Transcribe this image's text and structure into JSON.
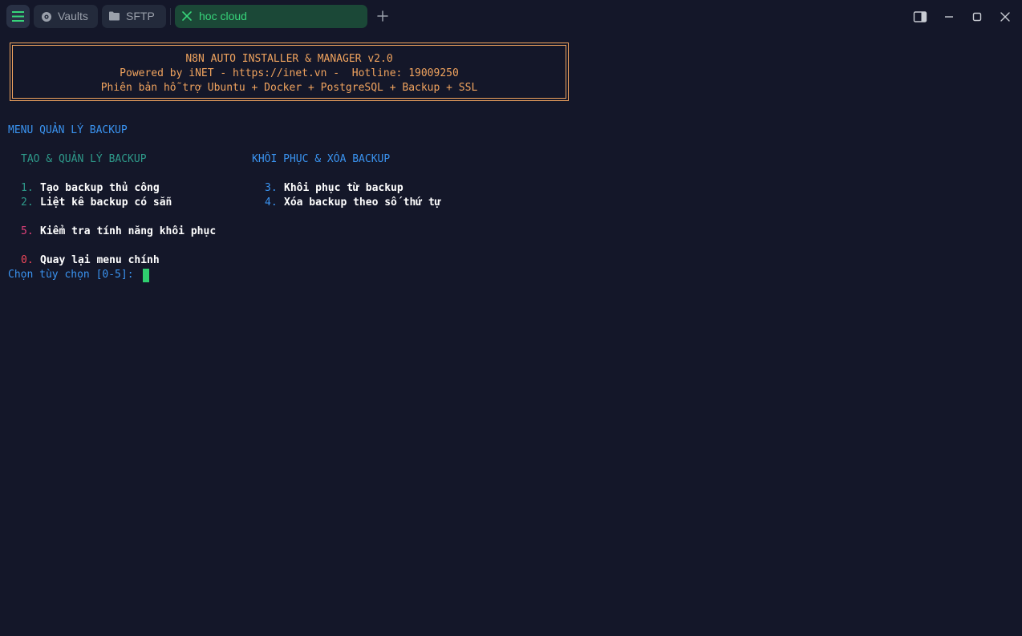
{
  "tabs": {
    "vaults_label": "Vaults",
    "sftp_label": "SFTP",
    "active_label": "hoc cloud"
  },
  "banner": {
    "line1": "N8N AUTO INSTALLER & MANAGER v2.0",
    "line2": "Powered by iNET - https://inet.vn -  Hotline: 19009250",
    "line3": "Phiên bản hỗ trợ Ubuntu + Docker + PostgreSQL + Backup + SSL"
  },
  "menu": {
    "title": "MENU QUẢN LÝ BACKUP",
    "left_header": "TẠO & QUẢN LÝ BACKUP",
    "right_header": "KHÔI PHỤC & XÓA BACKUP",
    "items": [
      {
        "num": "1.",
        "label": "Tạo backup thủ công"
      },
      {
        "num": "2.",
        "label": "Liệt kê backup có sẵn"
      },
      {
        "num": "3.",
        "label": "Khôi phục từ backup"
      },
      {
        "num": "4.",
        "label": "Xóa backup theo số thứ tự"
      },
      {
        "num": "5.",
        "label": "Kiểm tra tính năng khôi phục"
      },
      {
        "num": "0.",
        "label": "Quay lại menu chính"
      }
    ],
    "prompt": "Chọn tùy chọn [0-5]:"
  },
  "colors": {
    "background": "#141729",
    "banner": "#f0a35e",
    "accent_blue": "#3a93f0",
    "accent_teal": "#2e9a8a",
    "accent_green": "#37d47a",
    "option5": "#e0417a",
    "option0": "#f0475a"
  },
  "icons": {
    "menu": "hamburger-icon",
    "vaults": "vault-icon",
    "sftp": "folder-icon",
    "active_tab": "close-icon",
    "new_tab": "plus-icon",
    "sidebar_toggle": "sidebar-toggle-icon",
    "minimize": "minimize-icon",
    "maximize": "maximize-icon",
    "close": "window-close-icon"
  }
}
